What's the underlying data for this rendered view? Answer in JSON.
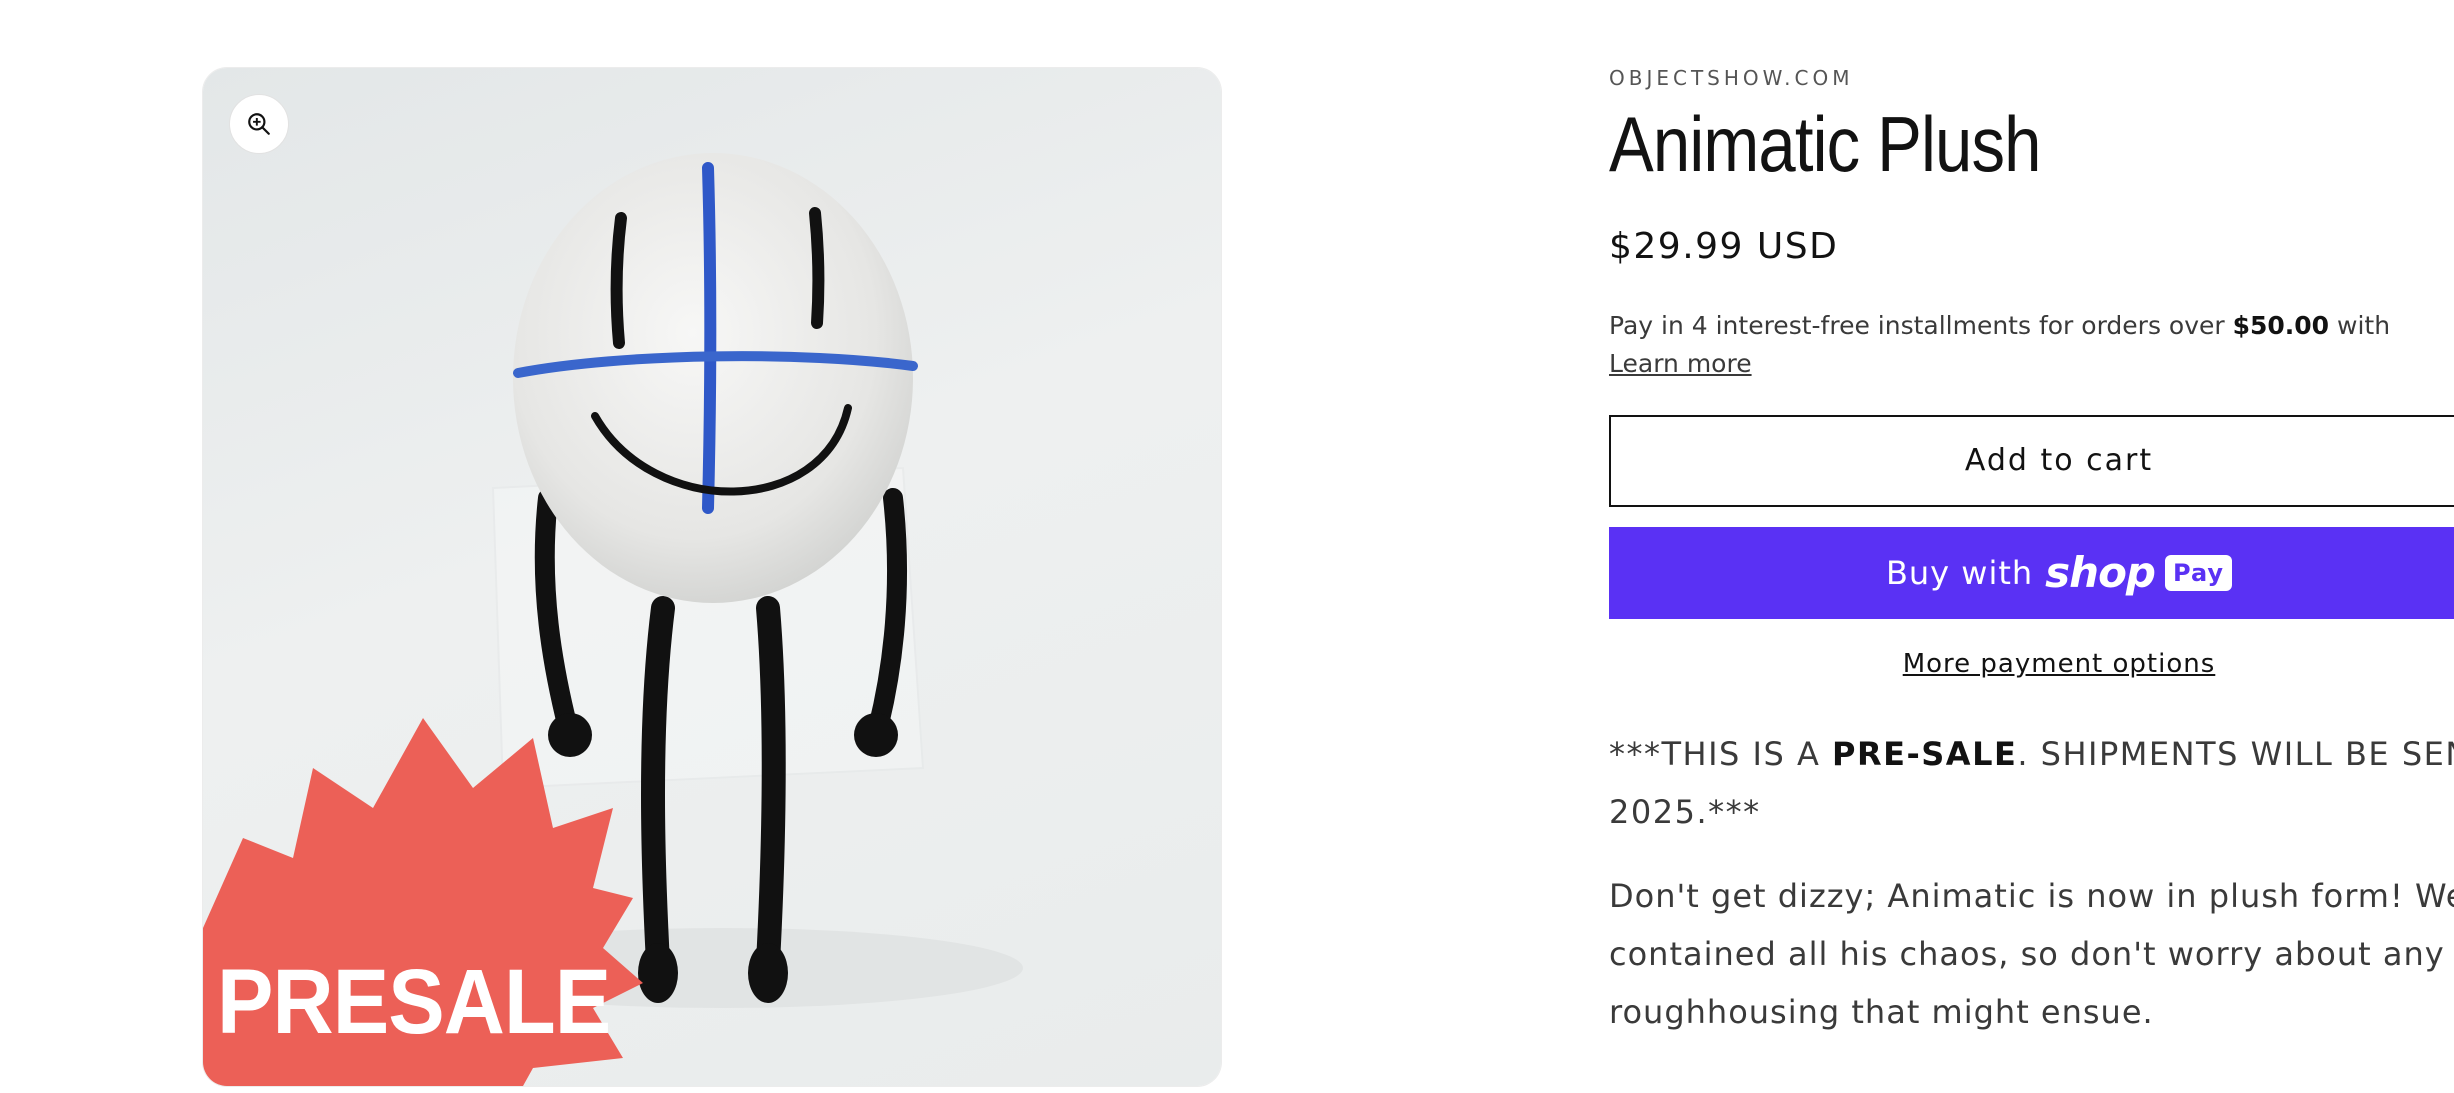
{
  "product": {
    "vendor": "OBJECTSHOW.COM",
    "title": "Animatic Plush",
    "price": "$29.99 USD",
    "image": {
      "badge_text": "PRESALE",
      "zoom_icon": "zoom-in-icon"
    }
  },
  "installments": {
    "text_before": "Pay in 4 interest-free installments for orders over ",
    "amount": "$50.00",
    "text_after": " with",
    "learn_more": "Learn more"
  },
  "actions": {
    "add_to_cart": "Add to cart",
    "buy_with": "Buy with",
    "shop_logo": "shop",
    "pay_badge": "Pay",
    "more_payment_options": "More payment options"
  },
  "description": {
    "presale_prefix": "***THIS IS A ",
    "presale_bold": "PRE-SALE",
    "presale_suffix_line1": ". SHIPMENTS WILL BE SENT",
    "presale_line2": "2025.***",
    "body_lines": [
      "Don't get dizzy; Animatic is now in plush form! We",
      "contained all his chaos, so don't worry about any",
      "roughhousing that might ensue."
    ]
  },
  "colors": {
    "shop_pay_purple": "#5a31f4",
    "presale_badge": "#ec6057"
  }
}
